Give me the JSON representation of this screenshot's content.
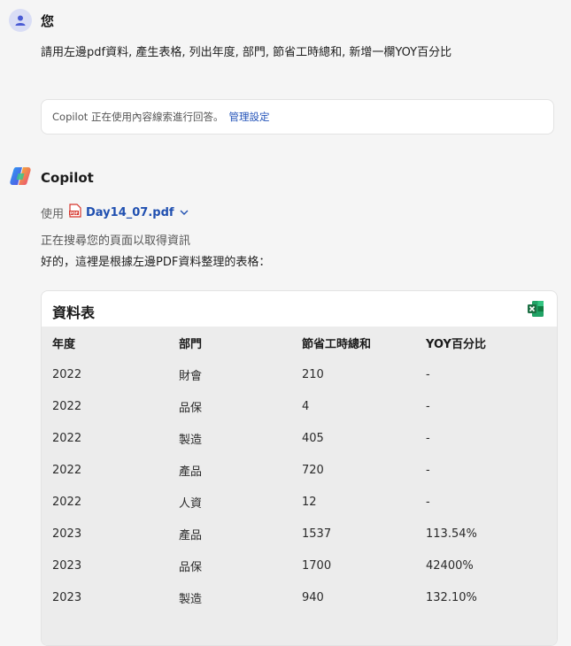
{
  "user": {
    "name": "您",
    "message": "請用左邊pdf資料, 產生表格, 列出年度, 部門, 節省工時總和, 新增一欄YOY百分比"
  },
  "notice": {
    "text": "Copilot 正在使用內容線索進行回答。",
    "link_label": "管理設定"
  },
  "assistant": {
    "name": "Copilot",
    "using_label": "使用",
    "file_name": "Day14_07.pdf",
    "status": "正在搜尋您的頁面以取得資訊",
    "intro": "好的，這裡是根據左邊PDF資料整理的表格："
  },
  "table": {
    "title": "資料表",
    "excel_icon": "excel-export-icon",
    "headers": [
      "年度",
      "部門",
      "節省工時總和",
      "YOY百分比"
    ],
    "rows": [
      [
        "2022",
        "財會",
        "210",
        "-"
      ],
      [
        "2022",
        "品保",
        "4",
        "-"
      ],
      [
        "2022",
        "製造",
        "405",
        "-"
      ],
      [
        "2022",
        "產品",
        "720",
        "-"
      ],
      [
        "2022",
        "人資",
        "12",
        "-"
      ],
      [
        "2023",
        "產品",
        "1537",
        "113.54%"
      ],
      [
        "2023",
        "品保",
        "1700",
        "42400%"
      ],
      [
        "2023",
        "製造",
        "940",
        "132.10%"
      ]
    ]
  },
  "colors": {
    "accent_link": "#2252b8",
    "excel_green": "#1d7044",
    "pdf_red": "#d6342b"
  }
}
